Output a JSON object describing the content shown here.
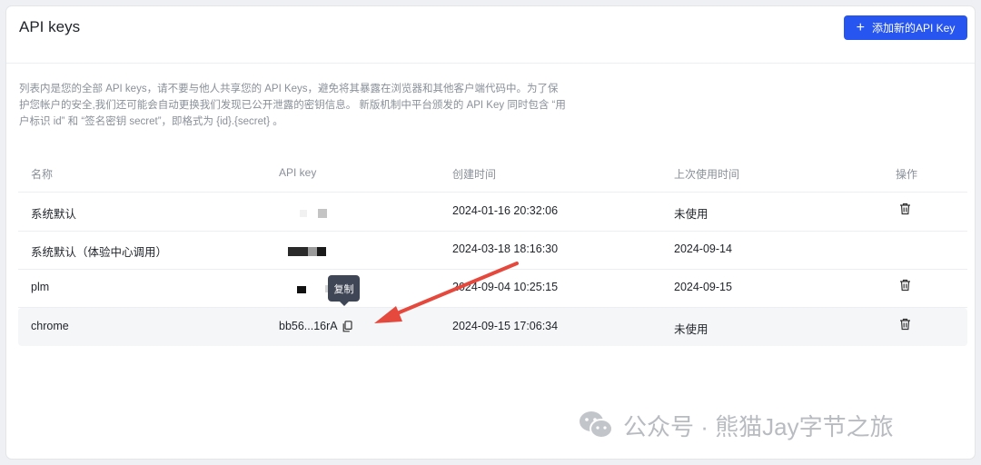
{
  "header": {
    "title": "API keys",
    "add_button_label": "添加新的API Key",
    "add_button_icon": "plus-icon"
  },
  "description": [
    "列表内是您的全部 API keys，请不要与他人共享您的 API Keys，避免将其暴露在浏览器和其他客户端代码中。为了保",
    "护您帐户的安全,我们还可能会自动更换我们发现已公开泄露的密钥信息。 新版机制中平台颁发的 API Key 同时包含 “用",
    "户标识 id” 和 “签名密钥 secret”，即格式为 {id}.{secret} 。"
  ],
  "table": {
    "columns": [
      "名称",
      "API key",
      "创建时间",
      "上次使用时间",
      "操作"
    ],
    "rows": [
      {
        "name": "系统默认",
        "api_key": "",
        "created": "2024-01-16 20:32:06",
        "last_used": "未使用",
        "action_icon": "trash-icon"
      },
      {
        "name": "系统默认（体验中心调用）",
        "api_key": "",
        "created": "2024-03-18 18:16:30",
        "last_used": "2024-09-14"
      },
      {
        "name": "plm",
        "api_key": "",
        "created": "2024-09-04 10:25:15",
        "last_used": "2024-09-15",
        "action_icon": "trash-icon"
      },
      {
        "name": "chrome",
        "api_key": "bb56...16rA",
        "created": "2024-09-15 17:06:34",
        "last_used": "未使用",
        "action_icon": "trash-icon",
        "key_action_icon": "copy-icon"
      }
    ]
  },
  "tooltip": {
    "text": "复制"
  },
  "annotation": {
    "color": "#e5483c"
  },
  "watermark": {
    "text": "公众号 · 熊猫Jay字节之旅",
    "icon": "wechat-icon"
  },
  "colors": {
    "primary": "#2655f0",
    "muted_text": "#8a9099",
    "row_hover": "#f5f6f8"
  }
}
